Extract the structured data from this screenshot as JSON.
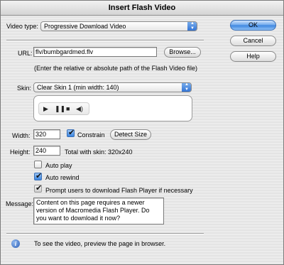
{
  "window": {
    "title": "Insert Flash Video"
  },
  "form": {
    "video_type_label": "Video type:",
    "video_type_value": "Progressive Download Video",
    "url_label": "URL:",
    "url_value": "flv/bumbgardmed.flv",
    "browse_label": "Browse...",
    "url_hint": "(Enter the relative or absolute path of the Flash Video file)",
    "skin_label": "Skin:",
    "skin_value": "Clear Skin 1 (min width: 140)",
    "width_label": "Width:",
    "width_value": "320",
    "constrain_label": "Constrain",
    "constrain_checked": true,
    "detect_size_label": "Detect Size",
    "height_label": "Height:",
    "height_value": "240",
    "total_with_skin": "Total with skin: 320x240",
    "auto_play_label": "Auto play",
    "auto_play_checked": false,
    "auto_rewind_label": "Auto rewind",
    "auto_rewind_checked": true,
    "prompt_label": "Prompt users to download Flash Player if necessary",
    "prompt_checked": true,
    "message_label": "Message:",
    "message_value": "Content on this page requires a newer version of Macromedia Flash Player. Do you want to download it now?"
  },
  "skin_preview": {
    "controls": [
      "play-icon",
      "pause-icon",
      "stop-icon",
      "volume-icon"
    ]
  },
  "buttons": {
    "ok": "OK",
    "cancel": "Cancel",
    "help": "Help"
  },
  "footer": {
    "info_text": "To see the video, preview the page in browser."
  },
  "colors": {
    "accent": "#3a84df",
    "info_icon": "#2d5fb5"
  }
}
